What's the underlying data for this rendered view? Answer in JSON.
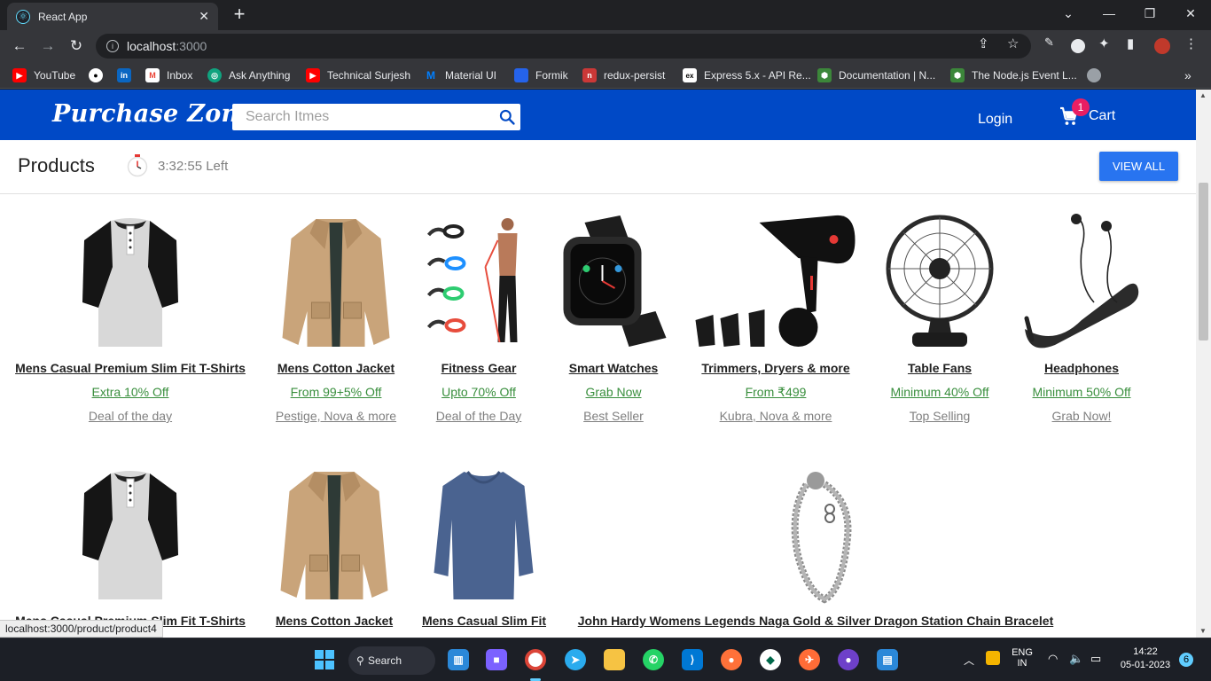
{
  "browser": {
    "tab_title": "React App",
    "favicon": "react-icon",
    "address_host": "localhost",
    "address_port": ":3000"
  },
  "bookmarks": [
    {
      "label": "YouTube",
      "icon": "youtube-icon",
      "color": "#ff0000"
    },
    {
      "label": "",
      "icon": "github-icon",
      "color": "#ffffff"
    },
    {
      "label": "",
      "icon": "linkedin-icon",
      "color": "#0a66c2"
    },
    {
      "label": "Inbox",
      "icon": "gmail-icon",
      "color": "#ea4335"
    },
    {
      "label": "Ask Anything",
      "icon": "chatgpt-icon",
      "color": "#10a37f"
    },
    {
      "label": "Technical Surjesh",
      "icon": "youtube-icon",
      "color": "#ff0000"
    },
    {
      "label": "Material UI",
      "icon": "mui-icon",
      "color": "#007fff"
    },
    {
      "label": "Formik",
      "icon": "formik-icon",
      "color": "#2563eb"
    },
    {
      "label": "redux-persist",
      "icon": "npm-icon",
      "color": "#cb3837"
    },
    {
      "label": "Express 5.x - API Re...",
      "icon": "express-icon",
      "color": "#ffffff"
    },
    {
      "label": "Documentation | N...",
      "icon": "nodejs-icon",
      "color": "#3c873a"
    },
    {
      "label": "The Node.js Event L...",
      "icon": "nodejs-icon",
      "color": "#3c873a"
    }
  ],
  "site": {
    "logo": "Purchase Zone",
    "search_placeholder": "Search Itmes",
    "login": "Login",
    "cart_label": "Cart",
    "cart_count": "1",
    "brand_color": "#0049c6"
  },
  "section": {
    "title": "Products",
    "timer": "3:32:55 Left",
    "view_all": "VIEW ALL"
  },
  "products_row1": [
    {
      "name": "Mens Casual Premium Slim Fit T-Shirts",
      "offer": "Extra 10% Off",
      "tag": "Deal of the day",
      "image": "tshirt-image"
    },
    {
      "name": "Mens Cotton Jacket",
      "offer": "From 99+5% Off",
      "tag": "Pestige, Nova & more",
      "image": "jacket-image"
    },
    {
      "name": "Fitness Gear",
      "offer": "Upto 70% Off",
      "tag": "Deal of the Day",
      "image": "fitness-image"
    },
    {
      "name": "Smart Watches",
      "offer": "Grab Now",
      "tag": "Best Seller",
      "image": "watch-image"
    },
    {
      "name": "Trimmers, Dryers & more",
      "offer": "From ₹499",
      "tag": "Kubra, Nova & more",
      "image": "dryer-image"
    },
    {
      "name": "Table Fans",
      "offer": "Minimum 40% Off",
      "tag": "Top Selling",
      "image": "fan-image"
    },
    {
      "name": "Headphones",
      "offer": "Minimum 50% Off",
      "tag": "Grab Now!",
      "image": "headphones-image"
    }
  ],
  "products_row2": [
    {
      "name": "Mens Casual Premium Slim Fit T-Shirts",
      "image": "tshirt-image"
    },
    {
      "name": "Mens Cotton Jacket",
      "image": "jacket-image"
    },
    {
      "name": "Mens Casual Slim Fit",
      "image": "sweater-image"
    },
    {
      "name": "John Hardy Womens Legends Naga Gold & Silver Dragon Station Chain Bracelet",
      "image": "bracelet-image"
    }
  ],
  "status_url": "localhost:3000/product/product4",
  "taskbar": {
    "search": "Search",
    "lang_1": "ENG",
    "lang_2": "IN",
    "time": "14:22",
    "date": "05-01-2023",
    "notifications": "6"
  }
}
